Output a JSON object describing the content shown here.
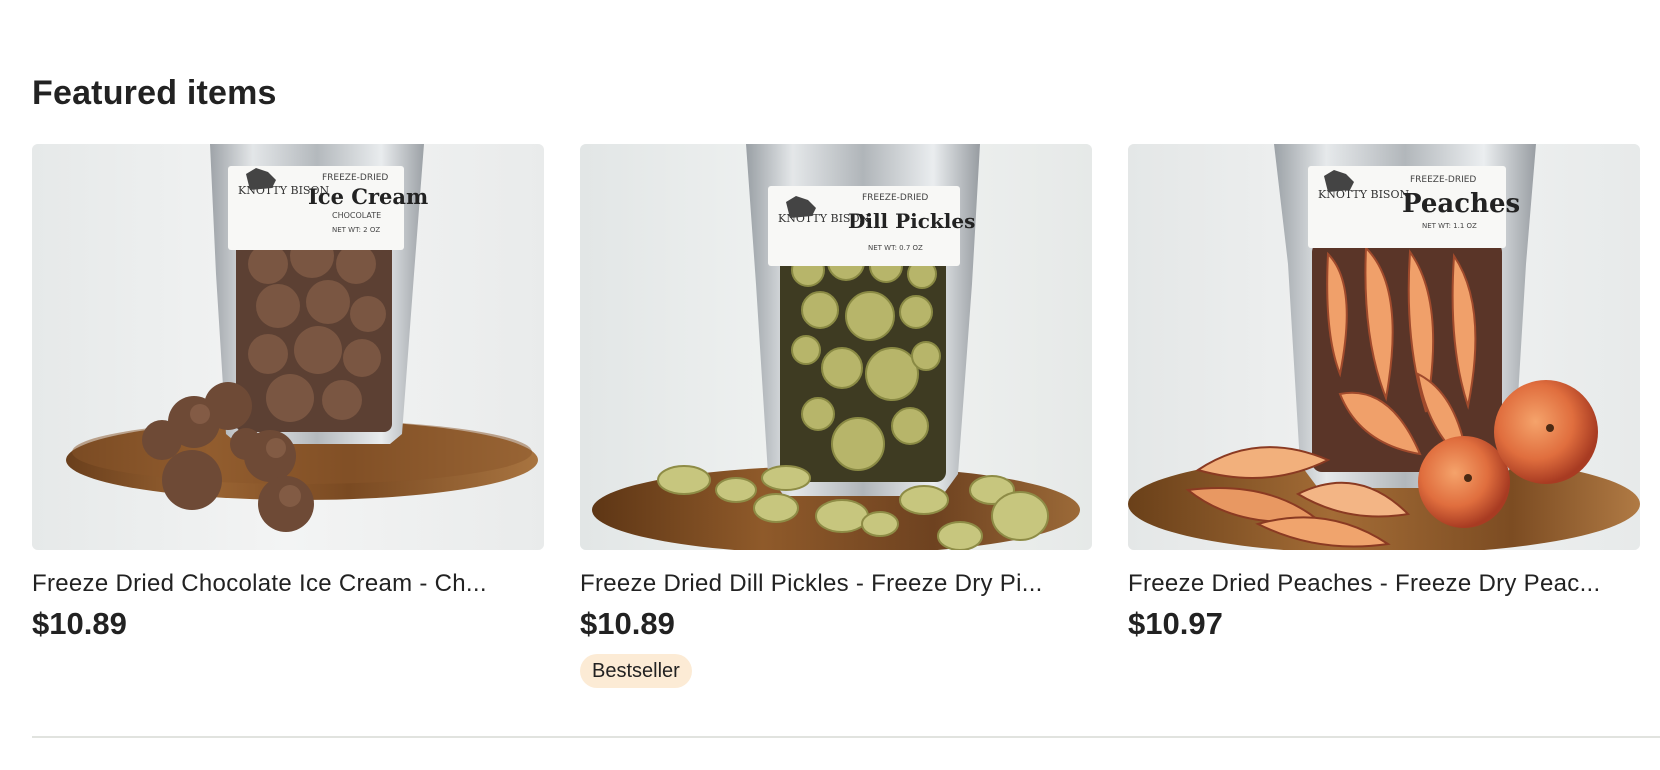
{
  "section": {
    "title": "Featured items"
  },
  "items": [
    {
      "title": "Freeze Dried Chocolate Ice Cream - Ch...",
      "price": "$10.89",
      "label": {
        "brand": "KNOTTY BISON",
        "kind": "FREEZE-DRIED",
        "product": "Ice Cream",
        "flavor": "CHOCOLATE",
        "weight": "NET WT: 2 OZ"
      }
    },
    {
      "title": "Freeze Dried Dill Pickles - Freeze Dry Pi...",
      "price": "$10.89",
      "badge": "Bestseller",
      "label": {
        "brand": "KNOTTY BISON",
        "kind": "FREEZE-DRIED",
        "product": "Dill Pickles",
        "weight": "NET WT: 0.7 OZ"
      }
    },
    {
      "title": "Freeze Dried Peaches - Freeze Dry Peac...",
      "price": "$10.97",
      "label": {
        "brand": "KNOTTY BISON",
        "kind": "FREEZE-DRIED",
        "product": "Peaches",
        "weight": "NET WT: 1.1 OZ"
      }
    }
  ],
  "colors": {
    "badge_bg": "#fcebd5",
    "text": "#222222",
    "divider": "#e1e3df"
  }
}
